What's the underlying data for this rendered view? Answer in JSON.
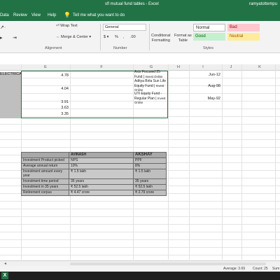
{
  "window": {
    "title": "sfl mutual fund tables  -  Excel",
    "user": "ramyatottempu"
  },
  "menu": {
    "items": [
      "Data",
      "Review",
      "View",
      "Help"
    ],
    "tell_me": "Tell me what you want to do"
  },
  "ribbon": {
    "wrap_text": "Wrap Text",
    "merge_center": "Merge & Center",
    "number_format": "General",
    "percent": "%",
    "comma": ",",
    "decimal": ".00",
    "conditional": [
      "Conditional",
      "Formatting"
    ],
    "format_as": [
      "Format as",
      "Table"
    ],
    "styles": {
      "normal": "Normal",
      "bad": "Bad",
      "good": "Good",
      "neutral": "Neutral"
    },
    "group_labels": {
      "alignment": "Alignment",
      "number": "Number",
      "styles": "Styles"
    }
  },
  "columns": [
    "E",
    "F",
    "G",
    "H",
    "I",
    "J",
    "K"
  ],
  "cells": {
    "electrical": "ELECTRICAL",
    "e_values": [
      "4.78",
      "4.04",
      "3.91",
      "3.63",
      "3.35"
    ],
    "funds": [
      {
        "line1": "Axis Focused 25",
        "line2": "Fund",
        "line3": "Invest Online",
        "date": "Jun-12"
      },
      {
        "line1": "Aditya Birla Sun Life",
        "line2": "Equity Fund",
        "line3": "Invest Online",
        "date": "Aug-98"
      },
      {
        "line1": "UTI Equity Fund -",
        "line2": "Regular Plan",
        "line3": "Invest Online",
        "date": "May-92"
      }
    ]
  },
  "comparison": {
    "headers": [
      "",
      "AVINASH",
      "AKSHAY"
    ],
    "rows": [
      {
        "label": "Investment Product picked",
        "a": "NPS",
        "b": "PPF"
      },
      {
        "label": "Average annual return",
        "a": "10%",
        "b": "8%"
      },
      {
        "label": "Investment amount every year",
        "a": "₹ 1.5 lakh",
        "b": "₹ 1.5 lakh"
      },
      {
        "label": "Investment time period",
        "a": "35 years",
        "b": "35 years"
      },
      {
        "label": "Investment in 35 years",
        "a": "₹ 52.5 lakh",
        "b": "₹ 52.5 lakh"
      },
      {
        "label": "Retirement corpus",
        "a": "₹ 4.47 crore",
        "b": "₹ 2.79 crore"
      }
    ]
  },
  "status": {
    "average": "Average: 3.69",
    "count": "Count: 25",
    "sum": "Sum"
  }
}
